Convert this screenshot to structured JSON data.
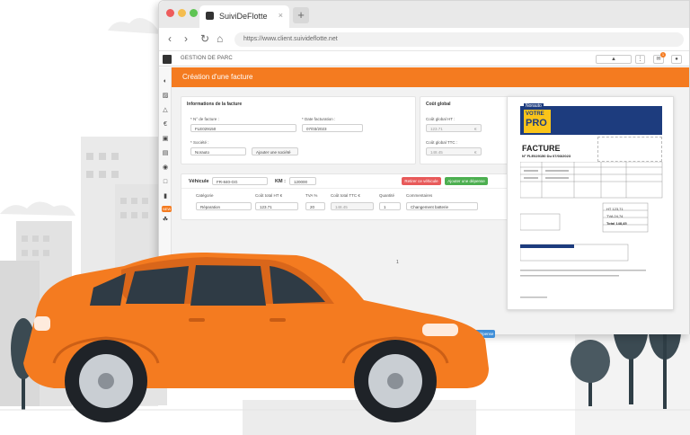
{
  "browser": {
    "tab_title": "SuiviDeFlotte",
    "tab_close": "×",
    "new_tab": "+",
    "url": "https://www.client.suivideflotte.net",
    "nav": {
      "back": "‹",
      "forward": "›",
      "reload": "↻",
      "home": "⌂"
    }
  },
  "app": {
    "brand": "GESTION DE PARC",
    "page_title": "Création d'une facture",
    "sidebar_badge": "NEW",
    "topbar_badge": "1"
  },
  "invoice_info": {
    "title": "Informations de la facture",
    "invoice_no_label": "* N° de facture :",
    "invoice_no_value": "FLE029150",
    "date_label": "* Date facturation :",
    "date_value": "07/03/2023",
    "company_label": "* Société :",
    "company_value": "Norauto",
    "add_company": "Ajouter une société"
  },
  "global_cost": {
    "title": "Coût global",
    "ht_label": "Coût global HT :",
    "ht_value": "123.71",
    "ttc_label": "Coût global TTC :",
    "ttc_value": "148.45",
    "currency": "€"
  },
  "vehicle": {
    "label": "Véhicule",
    "plate": "FR-840-GG",
    "km_label": "KM :",
    "km_value": "120000",
    "remove_btn": "Retirer ce véhicule",
    "add_expense_btn": "Ajouter une dépense",
    "columns": [
      "Catégorie",
      "Coût total HT €",
      "TVA %",
      "Coût total TTC €",
      "Quantité",
      "Commentaires"
    ],
    "row": {
      "category": "Réparation",
      "ht": "123.71",
      "tva": "20",
      "ttc": "148.45",
      "qty": "1",
      "comment": "Changement batterie"
    }
  },
  "pagination": "1",
  "actions": {
    "add_vehicle": "Ajouter un véhicule",
    "create_expense": "Créer cette dépense"
  },
  "invoice_preview": {
    "brand": "Norauto",
    "banner_line1": "VOTRE",
    "banner_line2": "PRO",
    "heading": "FACTURE",
    "number_line": "N° FLE029150 Du 07/03/2023",
    "totals": [
      {
        "label": "HT",
        "value": "123,71"
      },
      {
        "label": "TVA",
        "value": "24,74"
      },
      {
        "label": "Total",
        "value": "148,45"
      }
    ]
  },
  "colors": {
    "accent": "#f47b20",
    "danger": "#e85a5a",
    "success": "#4caf50",
    "primary": "#3f8ed8",
    "car": "#f47b20"
  }
}
